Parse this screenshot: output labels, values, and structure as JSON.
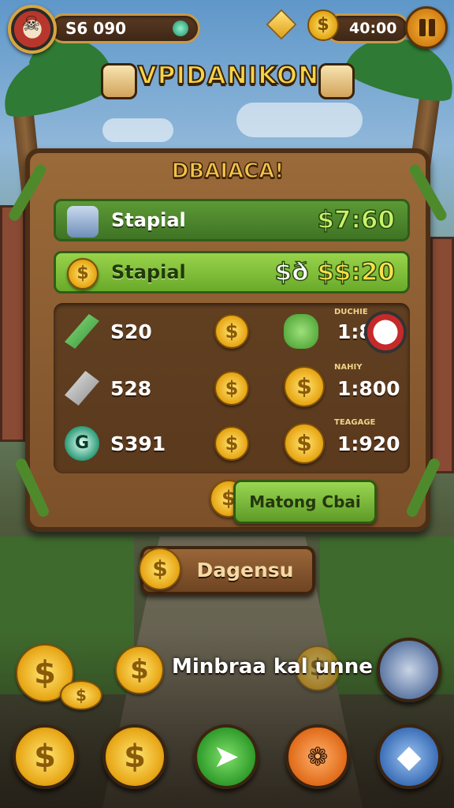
{
  "hud": {
    "currency_left": "S6 090",
    "currency_right": "4",
    "currency_right_value": "40:00",
    "coin_symbol": "$"
  },
  "title": "VPIDANIKON",
  "board": {
    "header": "DBAIACA!",
    "rows": [
      {
        "label": "Stapial",
        "value": "$7:60"
      },
      {
        "label": "Stapial",
        "value_prefix": "$ð",
        "value": "$$:20"
      }
    ],
    "items_left": [
      {
        "value": "S20",
        "icon": "sword-icon"
      },
      {
        "value": "528",
        "icon": "hammer-icon"
      },
      {
        "value": "S391",
        "icon": "gem-icon"
      }
    ],
    "items_right": [
      {
        "caption": "DUCHIE",
        "value": "1:800",
        "icon": "cactus-icon"
      },
      {
        "caption": "NAHIY",
        "value": "1:800",
        "icon": "coin-icon"
      },
      {
        "caption": "TEAGAGE",
        "value": "1:920",
        "icon": "coin-icon"
      }
    ],
    "claim_button": "Matong Cbai"
  },
  "deposit_button": "Dagensu",
  "mint_text": "Minbraa kal unne",
  "colors": {
    "wood": "#7c5029",
    "green_accent": "#6aaa2a",
    "gold": "#e8a818"
  }
}
